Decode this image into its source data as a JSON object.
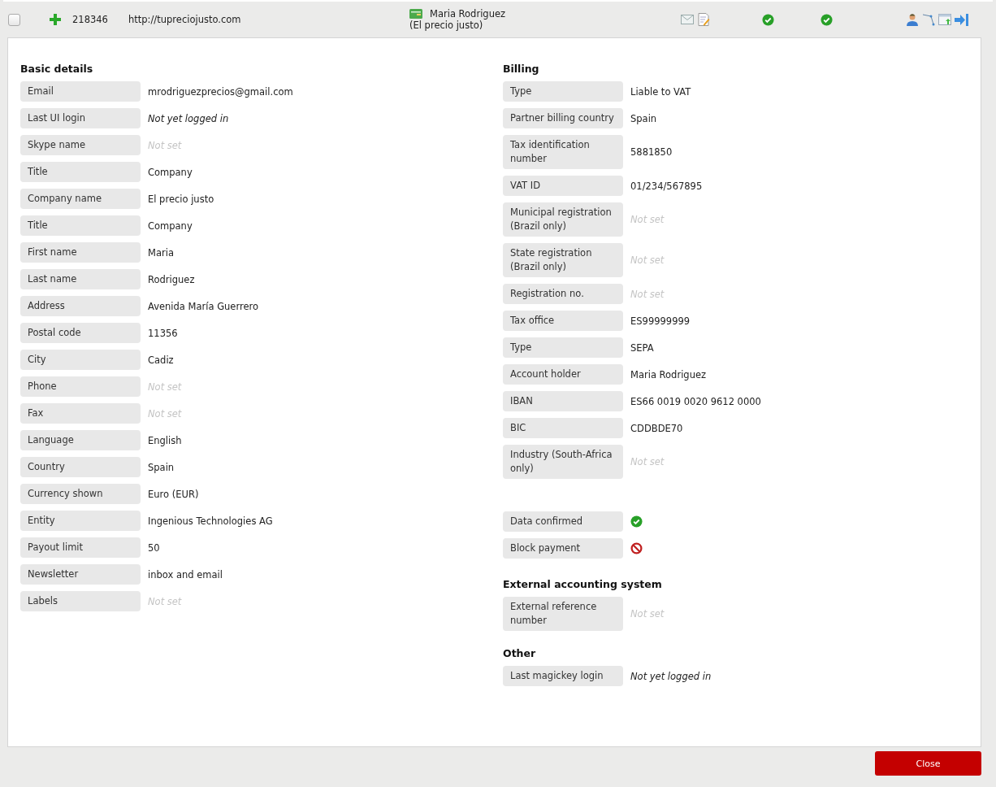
{
  "header": {
    "selected": false,
    "id": "218346",
    "url": "http://tupreciojusto.com",
    "name": "Maria Rodriguez",
    "company": "(El precio justo)"
  },
  "columns": [
    [
      {
        "title": "Basic details",
        "fields": [
          {
            "label": "Email",
            "value": "mrodriguezprecios@gmail.com",
            "kind": "text"
          },
          {
            "label": "Last UI login",
            "value": "Not yet logged in",
            "kind": "emphasis"
          },
          {
            "label": "Skype name",
            "value": "Not set",
            "kind": "unset"
          },
          {
            "label": "Title",
            "value": "Company",
            "kind": "text"
          },
          {
            "label": "Company name",
            "value": "El precio justo",
            "kind": "text"
          },
          {
            "label": "Title",
            "value": "Company",
            "kind": "text"
          },
          {
            "label": "First name",
            "value": "Maria",
            "kind": "text"
          },
          {
            "label": "Last name",
            "value": "Rodriguez",
            "kind": "text"
          },
          {
            "label": "Address",
            "value": "Avenida María Guerrero",
            "kind": "text"
          },
          {
            "label": "Postal code",
            "value": "11356",
            "kind": "text"
          },
          {
            "label": "City",
            "value": "Cadiz",
            "kind": "text"
          },
          {
            "label": "Phone",
            "value": "Not set",
            "kind": "unset"
          },
          {
            "label": "Fax",
            "value": "Not set",
            "kind": "unset"
          },
          {
            "label": "Language",
            "value": "English",
            "kind": "text"
          },
          {
            "label": "Country",
            "value": "Spain",
            "kind": "text"
          },
          {
            "label": "Currency shown",
            "value": "Euro (EUR)",
            "kind": "text"
          },
          {
            "label": "Entity",
            "value": "Ingenious Technologies AG",
            "kind": "text"
          },
          {
            "label": "Payout limit",
            "value": "50",
            "kind": "text"
          },
          {
            "label": "Newsletter",
            "value": "inbox and email",
            "kind": "text"
          },
          {
            "label": "Labels",
            "value": "Not set",
            "kind": "unset"
          }
        ]
      }
    ],
    [
      {
        "title": "Billing",
        "fields": [
          {
            "label": "Type",
            "value": "Liable to VAT",
            "kind": "text"
          },
          {
            "label": "Partner billing country",
            "value": "Spain",
            "kind": "text"
          },
          {
            "label": "Tax identification number",
            "value": "5881850",
            "kind": "text"
          },
          {
            "label": "VAT ID",
            "value": "01/234/567895",
            "kind": "text"
          },
          {
            "label": "Municipal registration (Brazil only)",
            "value": "Not set",
            "kind": "unset"
          },
          {
            "label": "State registration (Brazil only)",
            "value": "Not set",
            "kind": "unset"
          },
          {
            "label": "Registration no.",
            "value": "Not set",
            "kind": "unset"
          },
          {
            "label": "Tax office",
            "value": "ES99999999",
            "kind": "text"
          },
          {
            "label": "Type",
            "value": "SEPA",
            "kind": "text"
          },
          {
            "label": "Account holder",
            "value": "Maria Rodriguez",
            "kind": "text"
          },
          {
            "label": "IBAN",
            "value": "ES66 0019 0020 9612 0000",
            "kind": "text"
          },
          {
            "label": "BIC",
            "value": "CDDBDE70",
            "kind": "text"
          },
          {
            "label": "Industry (South-Africa only)",
            "value": "Not set",
            "kind": "unset"
          }
        ]
      },
      {
        "fields": [
          {
            "label": "Data confirmed",
            "kind": "check"
          },
          {
            "label": "Block payment",
            "kind": "block"
          }
        ]
      },
      {
        "title": "External accounting system",
        "fields": [
          {
            "label": "External reference number",
            "value": "Not set",
            "kind": "unset"
          }
        ]
      },
      {
        "title": "Other",
        "fields": [
          {
            "label": "Last magickey login",
            "value": "Not yet logged in",
            "kind": "emphasis"
          }
        ]
      }
    ]
  ],
  "close": "Close"
}
